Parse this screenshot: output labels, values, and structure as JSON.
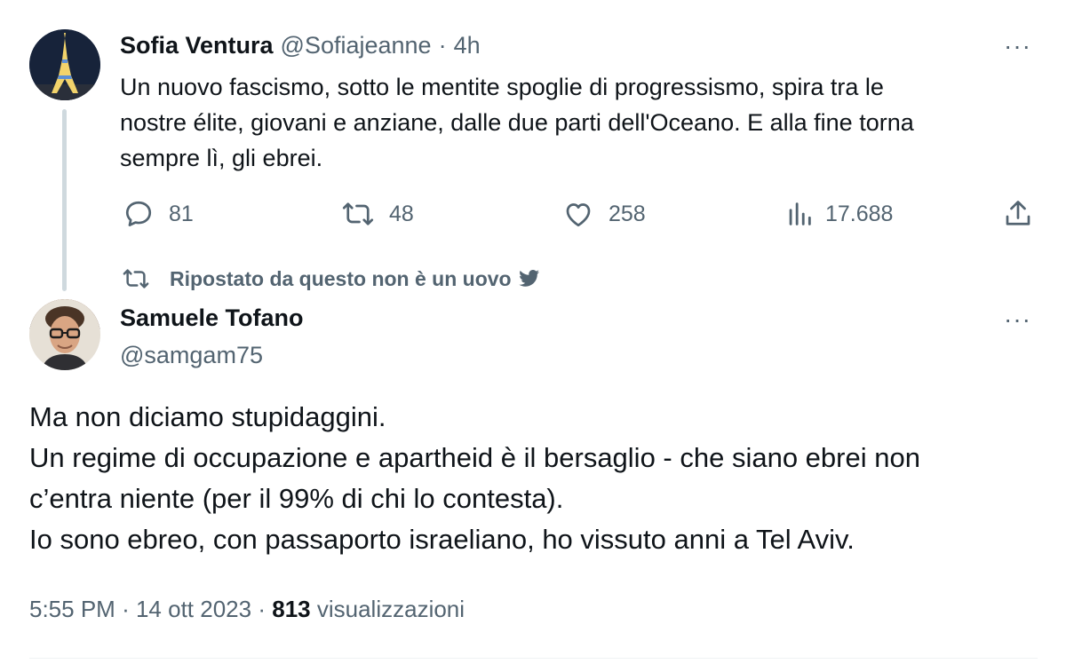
{
  "quoted_tweet": {
    "author_name": "Sofia Ventura",
    "author_handle": "@Sofiajeanne",
    "separator": "·",
    "time_ago": "4h",
    "text_lines": [
      "Un nuovo fascismo, sotto le mentite spoglie di progressismo, spira tra le",
      "nostre élite, giovani e anziane, dalle due parti dell'Oceano. E alla fine torna",
      "sempre lì, gli ebrei."
    ],
    "actions": {
      "replies": "81",
      "retweets": "48",
      "likes": "258",
      "views": "17.688"
    },
    "avatar_icon": "eiffel-tower-avatar"
  },
  "retweet_context": {
    "label": "Ripostato da questo non è un uovo",
    "icon": "twitter-bird-icon"
  },
  "main_tweet": {
    "author_name": "Samuele Tofano",
    "author_handle": "@samgam75",
    "text_lines": [
      "Ma non diciamo stupidaggini.",
      "Un regime di occupazione e apartheid è il bersaglio - che siano ebrei non",
      "c’entra niente (per il 99% di chi lo contesta).",
      "Io sono ebreo, con passaporto israeliano, ho vissuto anni a Tel Aviv."
    ],
    "meta": {
      "time": "5:55 PM",
      "sep1": "·",
      "date": "14 ott 2023",
      "sep2": "·",
      "views_count": "813",
      "views_label": "visualizzazioni"
    }
  },
  "more_label": "···",
  "colors": {
    "text_primary": "#0f1419",
    "text_secondary": "#536471",
    "thread_line": "#cfd9de",
    "twitter_blue": "#1d9bf0"
  }
}
